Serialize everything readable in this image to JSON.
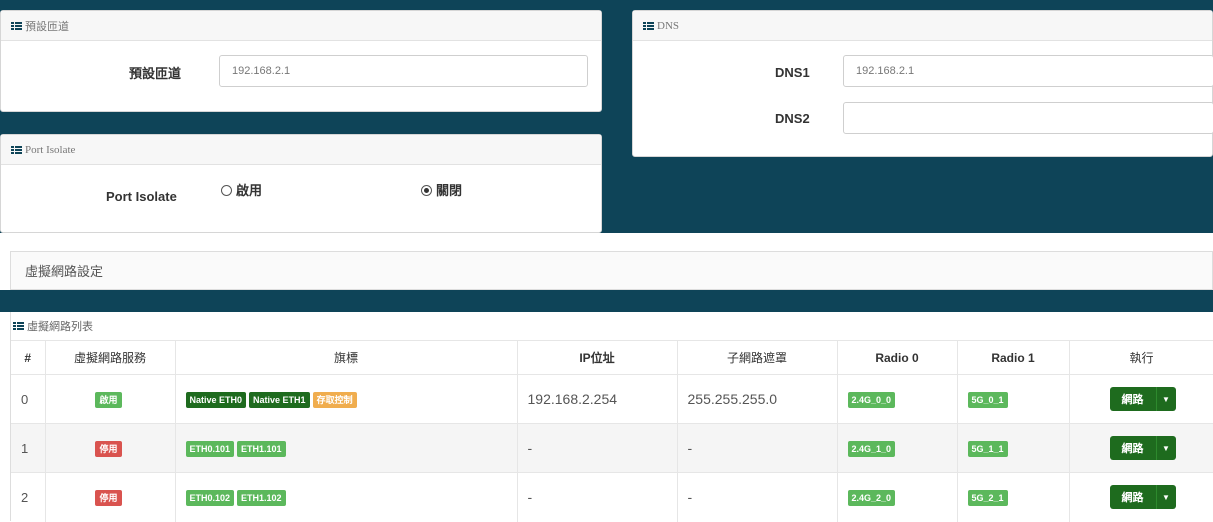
{
  "gateway_panel": {
    "title": "預設匝道",
    "label": "預設匝道",
    "value": "192.168.2.1"
  },
  "isolate_panel": {
    "title": "Port Isolate",
    "label": "Port Isolate",
    "enable_label": "啟用",
    "disable_label": "關閉",
    "selected": "關閉"
  },
  "dns_panel": {
    "title": "DNS",
    "dns1_label": "DNS1",
    "dns1_value": "192.168.2.1",
    "dns2_label": "DNS2",
    "dns2_value": ""
  },
  "vnet_settings": {
    "title": "虛擬網路設定"
  },
  "vnet_list": {
    "title": "虛擬網路列表",
    "columns": [
      "#",
      "虛擬網路服務",
      "旗標",
      "IP位址",
      "子網路遮罩",
      "Radio 0",
      "Radio 1",
      "執行"
    ],
    "rows": [
      {
        "index": "0",
        "service": "啟用",
        "service_color": "#5cb85c",
        "flags": [
          {
            "text": "Native ETH0",
            "color": "#1e6b1e"
          },
          {
            "text": "Native ETH1",
            "color": "#1e6b1e"
          },
          {
            "text": "存取控制",
            "color": "#f0ad4e"
          }
        ],
        "ip": "192.168.2.254",
        "mask": "255.255.255.0",
        "radio0": "2.4G_0_0",
        "radio1": "5G_0_1",
        "action": "網路"
      },
      {
        "index": "1",
        "service": "停用",
        "service_color": "#d9534f",
        "flags": [
          {
            "text": "ETH0.101",
            "color": "#5cb85c"
          },
          {
            "text": "ETH1.101",
            "color": "#5cb85c"
          }
        ],
        "ip": "-",
        "mask": "-",
        "radio0": "2.4G_1_0",
        "radio1": "5G_1_1",
        "action": "網路"
      },
      {
        "index": "2",
        "service": "停用",
        "service_color": "#d9534f",
        "flags": [
          {
            "text": "ETH0.102",
            "color": "#5cb85c"
          },
          {
            "text": "ETH1.102",
            "color": "#5cb85c"
          }
        ],
        "ip": "-",
        "mask": "-",
        "radio0": "2.4G_2_0",
        "radio1": "5G_2_1",
        "action": "網路"
      }
    ]
  },
  "colors": {
    "background_band": "#0e4458",
    "accent_dark_green": "#1e6b1e",
    "green": "#5cb85c",
    "red": "#d9534f",
    "orange": "#f0ad4e"
  }
}
